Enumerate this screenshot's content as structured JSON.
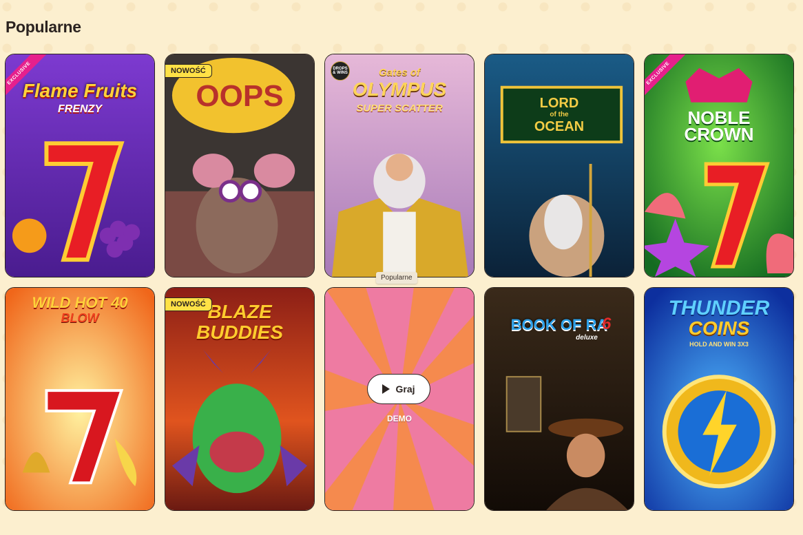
{
  "section": {
    "title": "Popularne"
  },
  "tooltip": "Popularne",
  "games": [
    {
      "title_line1": "Flame Fruits",
      "title_line2": "FRENZY",
      "ribbon": "EXCLUSIVE",
      "bg": "#6a2fb8"
    },
    {
      "title_line1": "OOPS",
      "badge": "NOWOŚĆ",
      "bg": "#3a3330"
    },
    {
      "title_line1": "Gates of",
      "title_line2": "OLYMPUS",
      "title_line3": "SUPER SCATTER",
      "drops": "DROPS & WINS",
      "bg": "#cfa3c8"
    },
    {
      "title_line1": "LORD",
      "title_line2": "of the",
      "title_line3": "OCEAN",
      "bg": "#123e63"
    },
    {
      "title_line1": "NOBLE",
      "title_line2": "CROWN",
      "ribbon": "EXCLUSIVE",
      "bg": "#1f8a34"
    },
    {
      "title_line1": "WILD HOT 40",
      "title_line2": "BLOW",
      "bg": "#f59a1c"
    },
    {
      "title_line1": "BLAZE",
      "title_line2": "BUDDIES",
      "badge": "NOWOŚĆ",
      "bg": "#a3281c"
    },
    {
      "play_label": "Graj",
      "demo_label": "DEMO",
      "bg": "#f07a4a"
    },
    {
      "title_line1": "BOOK OF RA",
      "title_line2": "deluxe",
      "title_line3": "6",
      "bg": "#2b1d12"
    },
    {
      "title_line1": "THUNDER",
      "title_line2": "COINS",
      "title_line3": "HOLD AND WIN 3X3",
      "bg": "#1b4fd1"
    }
  ]
}
